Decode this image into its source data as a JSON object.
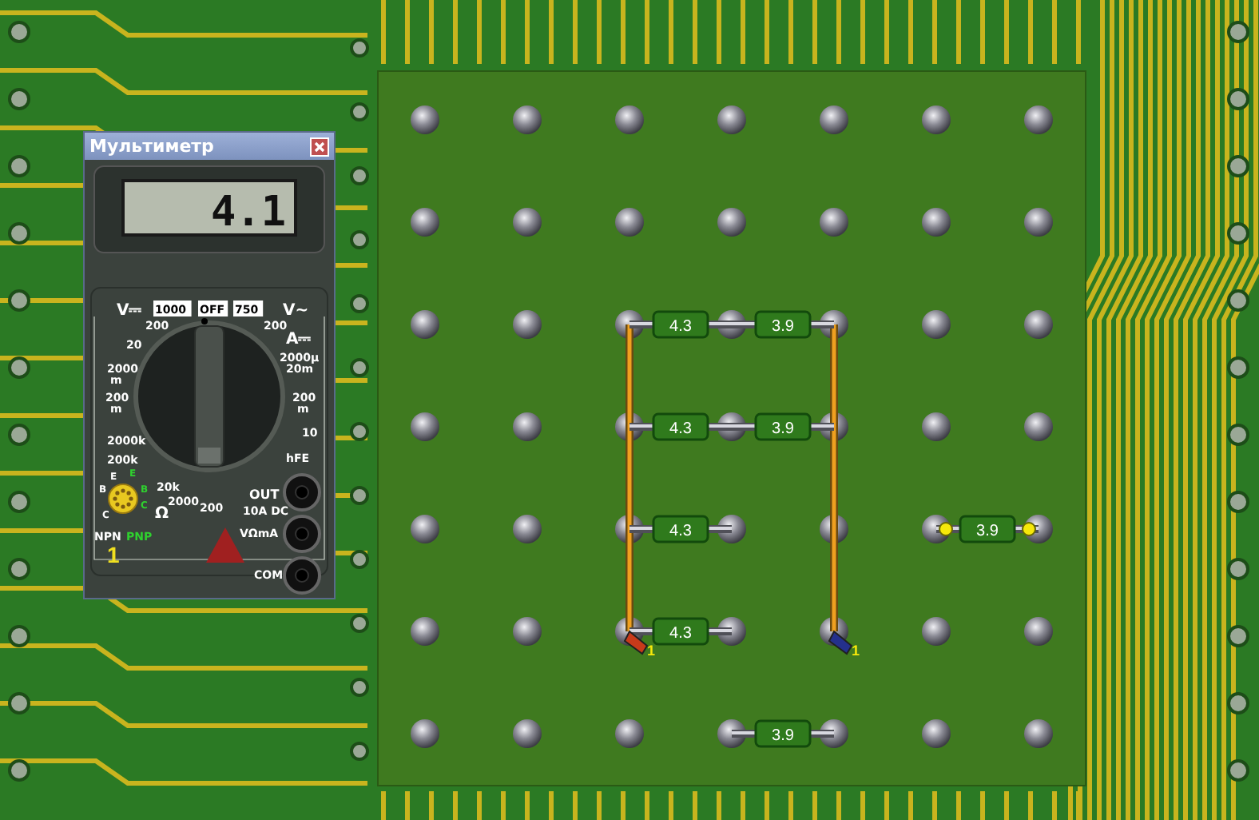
{
  "multimeter": {
    "title": "Мультиметр",
    "display": "4.1",
    "dial_labels": [
      {
        "text": "V⎓"
      },
      {
        "text": "1000"
      },
      {
        "text": "OFF"
      },
      {
        "text": "750"
      },
      {
        "text": "V~"
      },
      {
        "text": "200"
      },
      {
        "text": "200"
      },
      {
        "text": "20"
      },
      {
        "text": "A⎓"
      },
      {
        "text": "2000μ"
      },
      {
        "text": "2000"
      },
      {
        "text": "m"
      },
      {
        "text": "20m"
      },
      {
        "text": "200"
      },
      {
        "text": "m"
      },
      {
        "text": "200"
      },
      {
        "text": "m"
      },
      {
        "text": "2000k"
      },
      {
        "text": "10"
      },
      {
        "text": "200k"
      },
      {
        "text": "hFE"
      },
      {
        "text": "20k"
      },
      {
        "text": "Ω"
      },
      {
        "text": "2000"
      },
      {
        "text": "200"
      },
      {
        "text": "OUT"
      },
      {
        "text": "10A DC"
      },
      {
        "text": "VΩmA"
      },
      {
        "text": "COM"
      }
    ],
    "socket_labels": [
      {
        "text": "E"
      },
      {
        "text": "E"
      },
      {
        "text": "B"
      },
      {
        "text": "B"
      },
      {
        "text": "C"
      },
      {
        "text": "C"
      },
      {
        "text": "NPN"
      },
      {
        "text": "PNP"
      }
    ],
    "channel": "1"
  },
  "board": {
    "resistors": [
      {
        "value": "4.3",
        "selected": false
      },
      {
        "value": "3.9",
        "selected": false
      },
      {
        "value": "4.3",
        "selected": false
      },
      {
        "value": "3.9",
        "selected": false
      },
      {
        "value": "4.3",
        "selected": false
      },
      {
        "value": "3.9",
        "selected": true
      },
      {
        "value": "4.3",
        "selected": false
      },
      {
        "value": "3.9",
        "selected": false
      }
    ],
    "probes": [
      {
        "label": "1",
        "color": "#c83a1a"
      },
      {
        "label": "1",
        "color": "#24308c"
      }
    ]
  }
}
